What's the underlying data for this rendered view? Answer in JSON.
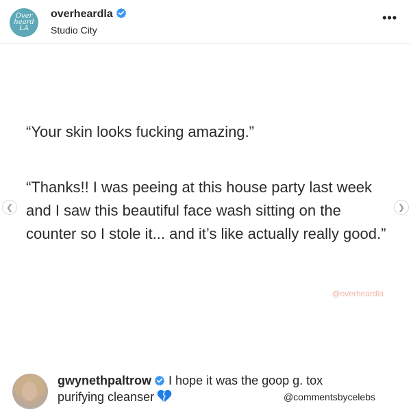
{
  "header": {
    "avatar_lines": [
      "Over",
      "heard",
      "LA"
    ],
    "username": "overheardla",
    "location": "Studio City",
    "more_icon": "more-options-icon"
  },
  "post": {
    "quote1": "“Your skin looks fucking amazing.”",
    "quote2": "“Thanks!! I was peeing at this house party last week and I saw this beautiful face wash sitting on the counter so I stole it... and it’s like actually really good.”",
    "watermark": "@overheardla",
    "nav_left_icon": "chevron-left-icon",
    "nav_right_icon": "chevron-right-icon"
  },
  "comment": {
    "username": "gwynethpaltrow",
    "text": "I hope it was the goop g. tox",
    "line2": "purifying cleanser",
    "heart_icon": "broken-blue-heart-icon",
    "credit": "@commentsbycelebs"
  },
  "colors": {
    "avatar_bg": "#5ea8b8",
    "verified": "#3897f0",
    "watermark": "#f0b6a8",
    "heart": "#1e7ee6"
  }
}
